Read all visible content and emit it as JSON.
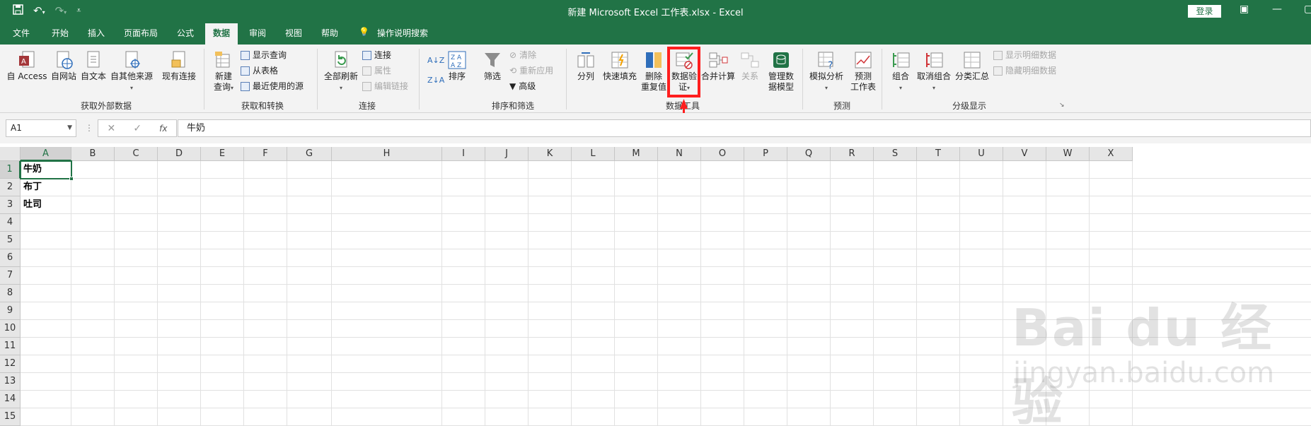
{
  "window": {
    "title": "新建 Microsoft Excel 工作表.xlsx  -  Excel",
    "login_label": "登录"
  },
  "tabs": [
    {
      "label": "文件"
    },
    {
      "label": "开始"
    },
    {
      "label": "插入"
    },
    {
      "label": "页面布局"
    },
    {
      "label": "公式"
    },
    {
      "label": "数据"
    },
    {
      "label": "审阅"
    },
    {
      "label": "视图"
    },
    {
      "label": "帮助"
    },
    {
      "label": "操作说明搜索"
    }
  ],
  "ribbon": {
    "get_external": {
      "label": "获取外部数据",
      "access": "自 Access",
      "web": "自网站",
      "text": "自文本",
      "other": "自其他来源",
      "existing": "现有连接"
    },
    "get_transform": {
      "label": "获取和转换",
      "new_query_1": "新建",
      "new_query_2": "查询",
      "show_queries": "显示查询",
      "from_table": "从表格",
      "recent_sources": "最近使用的源"
    },
    "connections": {
      "label": "连接",
      "refresh_all": "全部刷新",
      "connections": "连接",
      "properties": "属性",
      "edit_links": "编辑链接"
    },
    "sort_filter": {
      "label": "排序和筛选",
      "sort": "排序",
      "filter": "筛选",
      "clear": "清除",
      "reapply": "重新应用",
      "advanced": "高级"
    },
    "data_tools": {
      "label": "数据工具",
      "text_to_columns": "分列",
      "flash_fill": "快速填充",
      "remove_dup_1": "删除",
      "remove_dup_2": "重复值",
      "validation_1": "数据验",
      "validation_2": "证",
      "consolidate": "合并计算",
      "relationships": "关系",
      "data_model_1": "管理数",
      "data_model_2": "据模型"
    },
    "forecast": {
      "label": "预测",
      "what_if": "模拟分析",
      "forecast_1": "预测",
      "forecast_2": "工作表"
    },
    "outline": {
      "label": "分级显示",
      "group": "组合",
      "ungroup": "取消组合",
      "subtotal": "分类汇总",
      "show_detail": "显示明细数据",
      "hide_detail": "隐藏明细数据"
    }
  },
  "formula_bar": {
    "name_box": "A1",
    "fx": "fx",
    "value": "牛奶"
  },
  "columns": [
    "A",
    "B",
    "C",
    "D",
    "E",
    "F",
    "G",
    "H",
    "I",
    "J",
    "K",
    "L",
    "M",
    "N",
    "O",
    "P",
    "Q",
    "R",
    "S",
    "T",
    "U",
    "V",
    "W",
    "X"
  ],
  "rows": [
    "1",
    "2",
    "3",
    "4",
    "5",
    "6",
    "7",
    "8",
    "9",
    "10",
    "11",
    "12",
    "13",
    "14",
    "15"
  ],
  "cells": [
    {
      "ref": "A1",
      "value": "牛奶"
    },
    {
      "ref": "A2",
      "value": "布丁"
    },
    {
      "ref": "A3",
      "value": "吐司"
    }
  ],
  "watermark": {
    "main": "Bai du 经验",
    "sub": "jingyan.baidu.com"
  },
  "colors": {
    "excel_green": "#217346",
    "highlight_red": "#ff1e1e"
  }
}
